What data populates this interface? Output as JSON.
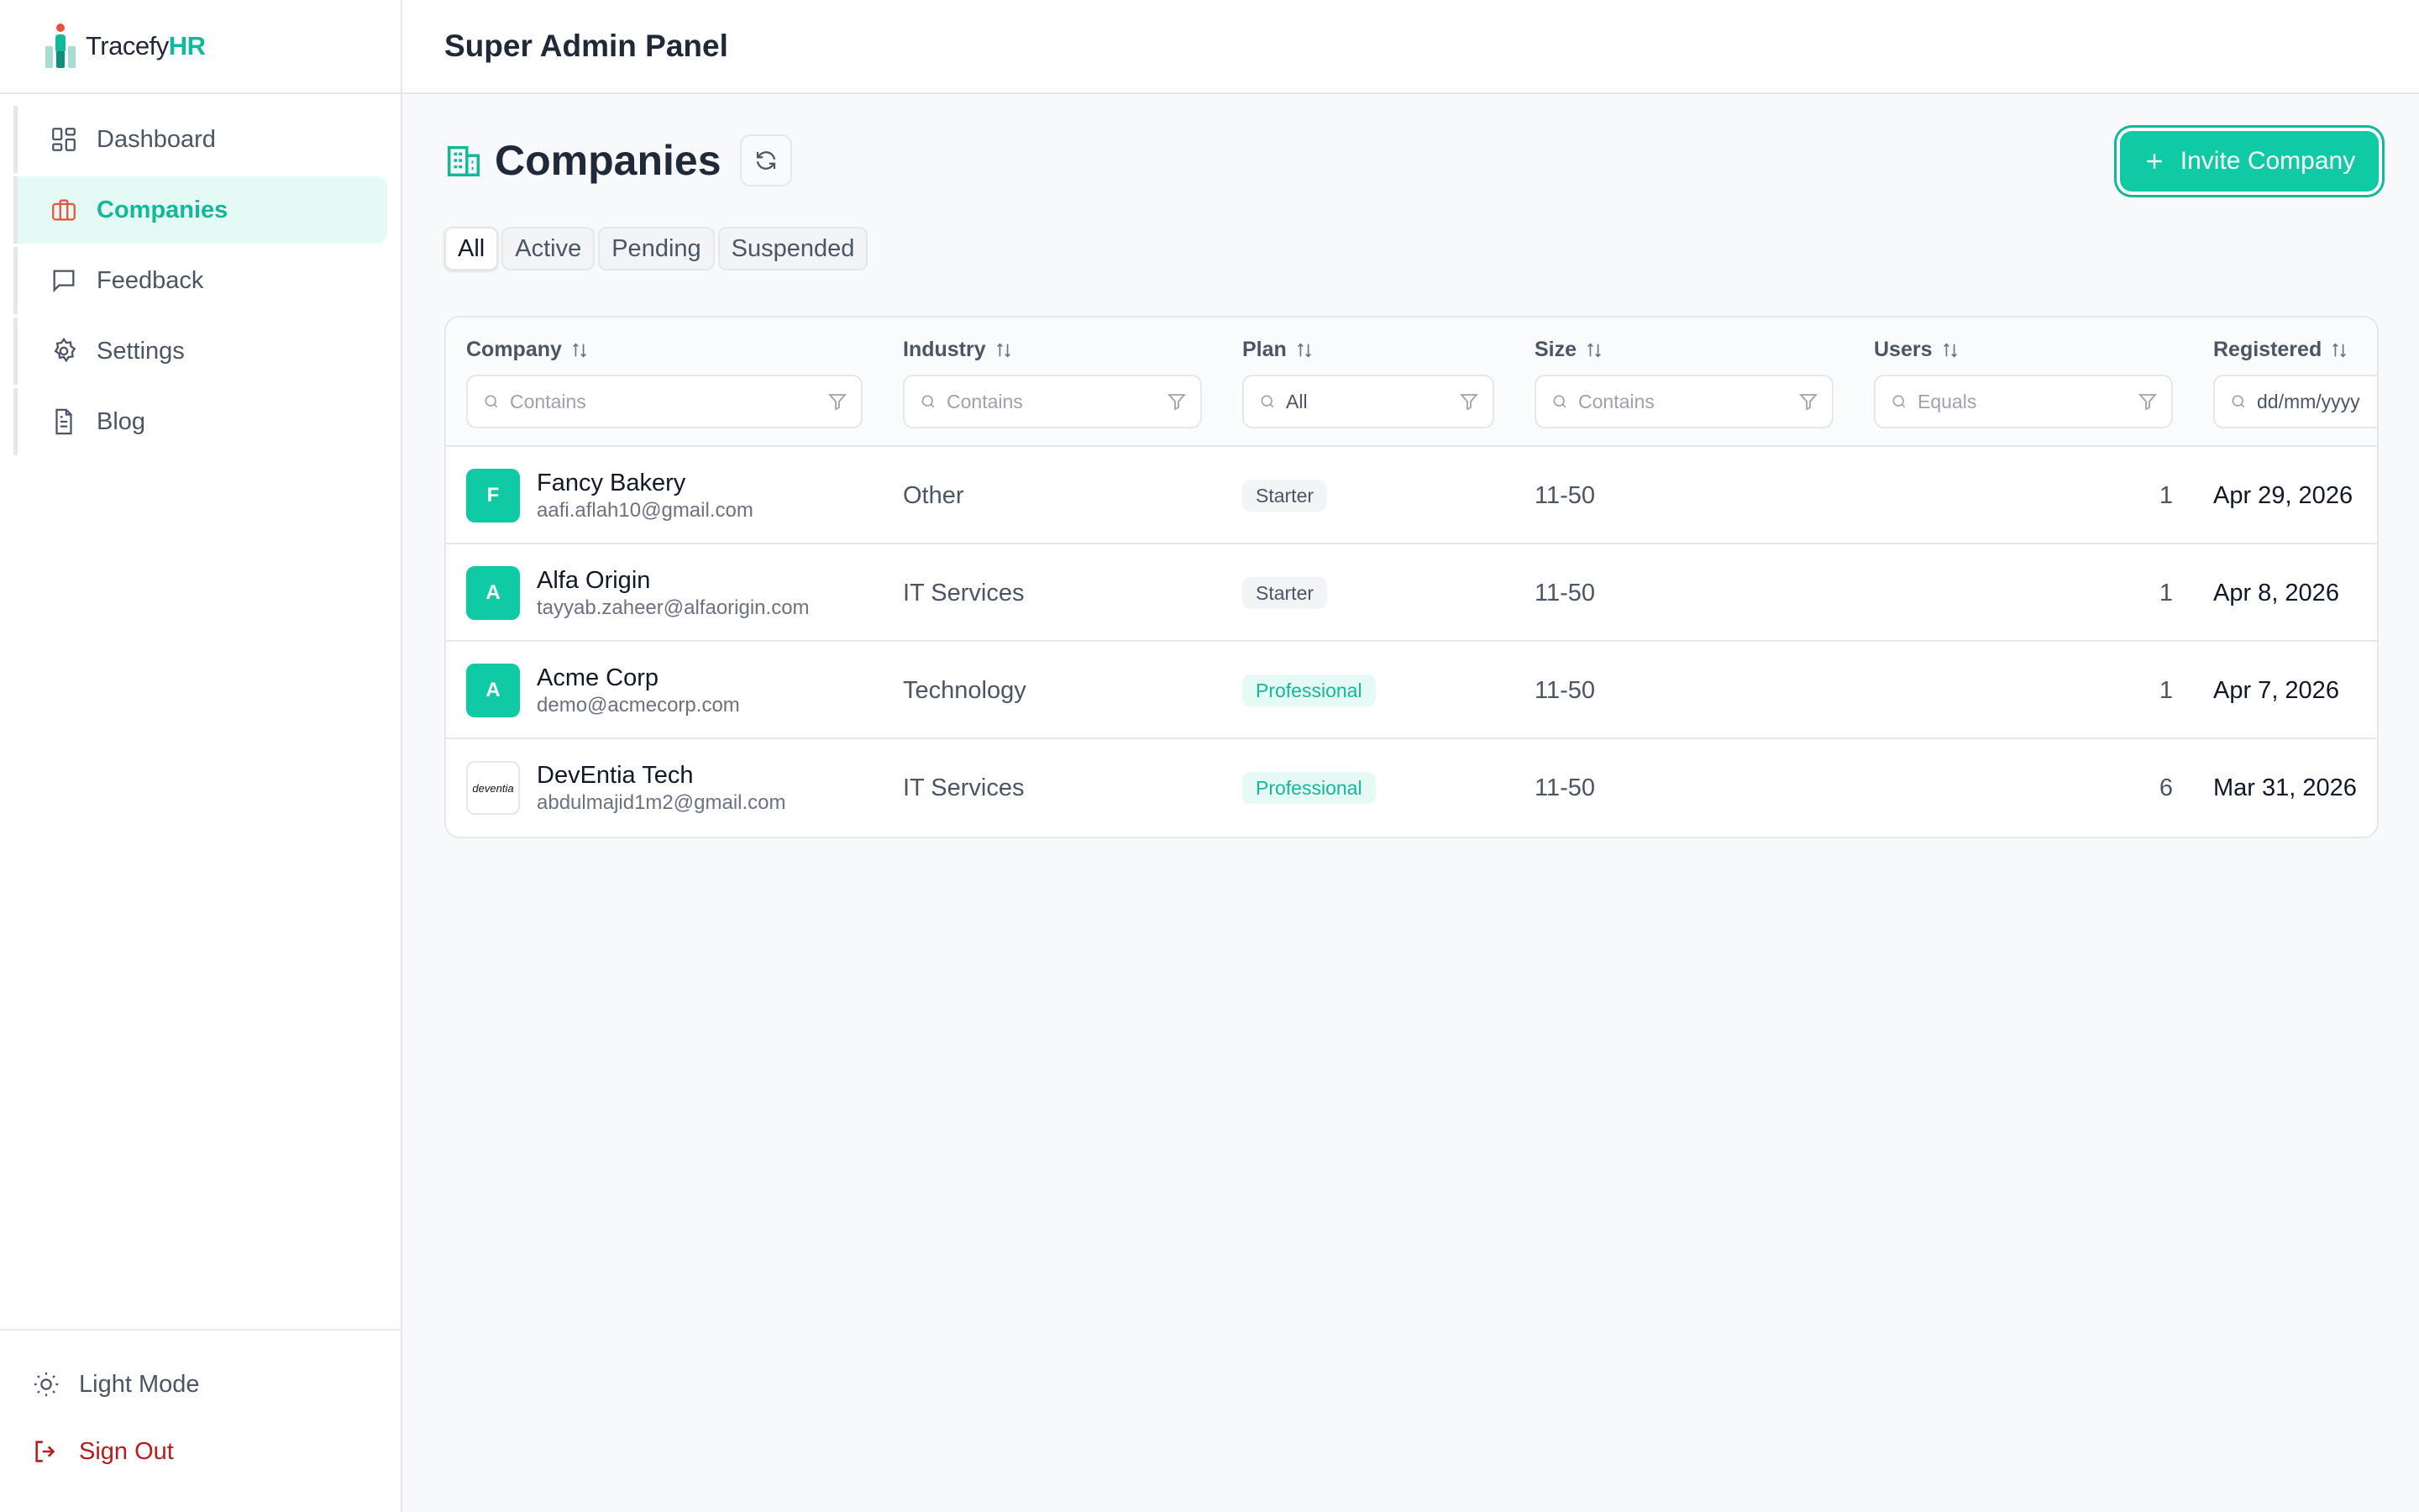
{
  "brand": {
    "name_part1": "Tracefy",
    "name_part2": "HR"
  },
  "sidebar": {
    "items": [
      {
        "label": "Dashboard",
        "icon": "dashboard-icon",
        "active": false
      },
      {
        "label": "Companies",
        "icon": "briefcase-icon",
        "active": true
      },
      {
        "label": "Feedback",
        "icon": "message-icon",
        "active": false
      },
      {
        "label": "Settings",
        "icon": "gear-icon",
        "active": false
      },
      {
        "label": "Blog",
        "icon": "document-icon",
        "active": false
      }
    ],
    "bottom": {
      "theme_label": "Light Mode",
      "signout_label": "Sign Out"
    }
  },
  "header": {
    "title": "Super Admin Panel"
  },
  "page": {
    "title": "Companies",
    "invite_label": "Invite Company",
    "tabs": [
      "All",
      "Active",
      "Pending",
      "Suspended"
    ],
    "active_tab": "All"
  },
  "table": {
    "columns": [
      {
        "label": "Company",
        "filter_placeholder": "Contains"
      },
      {
        "label": "Industry",
        "filter_placeholder": "Contains"
      },
      {
        "label": "Plan",
        "filter_placeholder": "All"
      },
      {
        "label": "Size",
        "filter_placeholder": "Contains"
      },
      {
        "label": "Users",
        "filter_placeholder": "Equals"
      },
      {
        "label": "Registered",
        "filter_placeholder": "dd/mm/yyyy"
      }
    ],
    "rows": [
      {
        "initial": "F",
        "name": "Fancy Bakery",
        "email": "aafi.aflah10@gmail.com",
        "industry": "Other",
        "plan": "Starter",
        "size": "11-50",
        "users": "1",
        "registered": "Apr 29, 2026"
      },
      {
        "initial": "A",
        "name": "Alfa Origin",
        "email": "tayyab.zaheer@alfaorigin.com",
        "industry": "IT Services",
        "plan": "Starter",
        "size": "11-50",
        "users": "1",
        "registered": "Apr 8, 2026"
      },
      {
        "initial": "A",
        "name": "Acme Corp",
        "email": "demo@acmecorp.com",
        "industry": "Technology",
        "plan": "Professional",
        "size": "11-50",
        "users": "1",
        "registered": "Apr 7, 2026"
      },
      {
        "initial": "deventia",
        "name": "DevEntia Tech",
        "email": "abdulmajid1m2@gmail.com",
        "industry": "IT Services",
        "plan": "Professional",
        "size": "11-50",
        "users": "6",
        "registered": "Mar 31, 2026"
      }
    ]
  },
  "colors": {
    "accent": "#10c9a5",
    "accent_text": "#10b99a",
    "danger": "#b91c1c",
    "briefcase": "#e5533d"
  }
}
